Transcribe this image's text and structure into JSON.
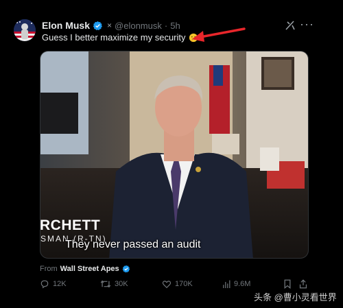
{
  "post": {
    "author_name": "Elon Musk",
    "x_mark": "×",
    "handle": "@elonmusk",
    "separator": "·",
    "time": "5h",
    "more_label": "···",
    "text": "Guess I better maximize my security",
    "emoji": "thinking-face-icon"
  },
  "video": {
    "lower_third_name": "RCHETT",
    "lower_third_title": "SMAN (R-TN)",
    "caption": "They never passed an audit"
  },
  "source": {
    "prefix": "From",
    "account": "Wall Street Apes"
  },
  "actions": {
    "replies": "12K",
    "reposts": "30K",
    "likes": "170K",
    "views": "9.6M"
  },
  "watermark": "头条 @曹小灵看世界",
  "colors": {
    "background": "#000000",
    "muted": "#71767b",
    "verified": "#1d9bf0",
    "arrow": "#e8262b"
  }
}
